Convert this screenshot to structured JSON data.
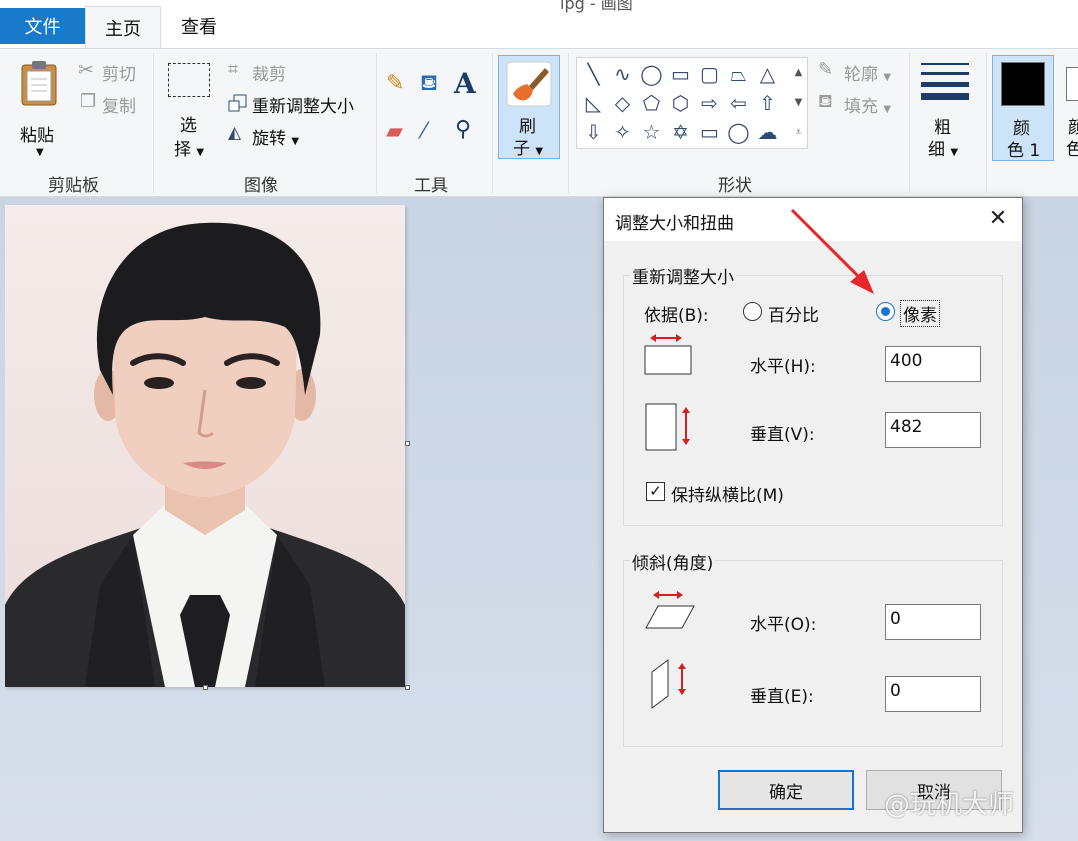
{
  "window": {
    "title_fragment": "ipg - 画图"
  },
  "tabs": {
    "file": "文件",
    "home": "主页",
    "view": "查看"
  },
  "clipboard": {
    "paste": "粘贴",
    "cut": "剪切",
    "copy": "复制",
    "group": "剪贴板"
  },
  "image_group": {
    "select_line1": "选",
    "select_line2": "择",
    "crop": "裁剪",
    "resize": "重新调整大小",
    "rotate": "旋转",
    "group": "图像"
  },
  "tools": {
    "group": "工具"
  },
  "brushes": {
    "line1": "刷",
    "line2": "子"
  },
  "shapes": {
    "outline": "轮廓",
    "fill": "填充",
    "group": "形状"
  },
  "size": {
    "line1": "粗",
    "line2": "细"
  },
  "colors": {
    "color1_line1": "颜",
    "color1_line2": "色 1",
    "color2_line1": "颜",
    "color2_line2": "色",
    "color1_swatch": "#000000"
  },
  "dialog": {
    "title": "调整大小和扭曲",
    "resize_group": "重新调整大小",
    "by_label": "依据(B):",
    "percent_label": "百分比",
    "pixels_label": "像素",
    "selected_unit": "pixels",
    "horizontal_label": "水平(H):",
    "horizontal_value": "400",
    "vertical_label": "垂直(V):",
    "vertical_value": "482",
    "maintain_aspect_label": "保持纵横比(M)",
    "maintain_aspect_checked": true,
    "skew_group": "倾斜(角度)",
    "skew_h_label": "水平(O):",
    "skew_h_value": "0",
    "skew_v_label": "垂直(E):",
    "skew_v_value": "0",
    "ok": "确定",
    "cancel": "取消"
  },
  "watermark": "@玩机大师",
  "accent_color": "#1979ca",
  "annotation_color": "#e5262b"
}
